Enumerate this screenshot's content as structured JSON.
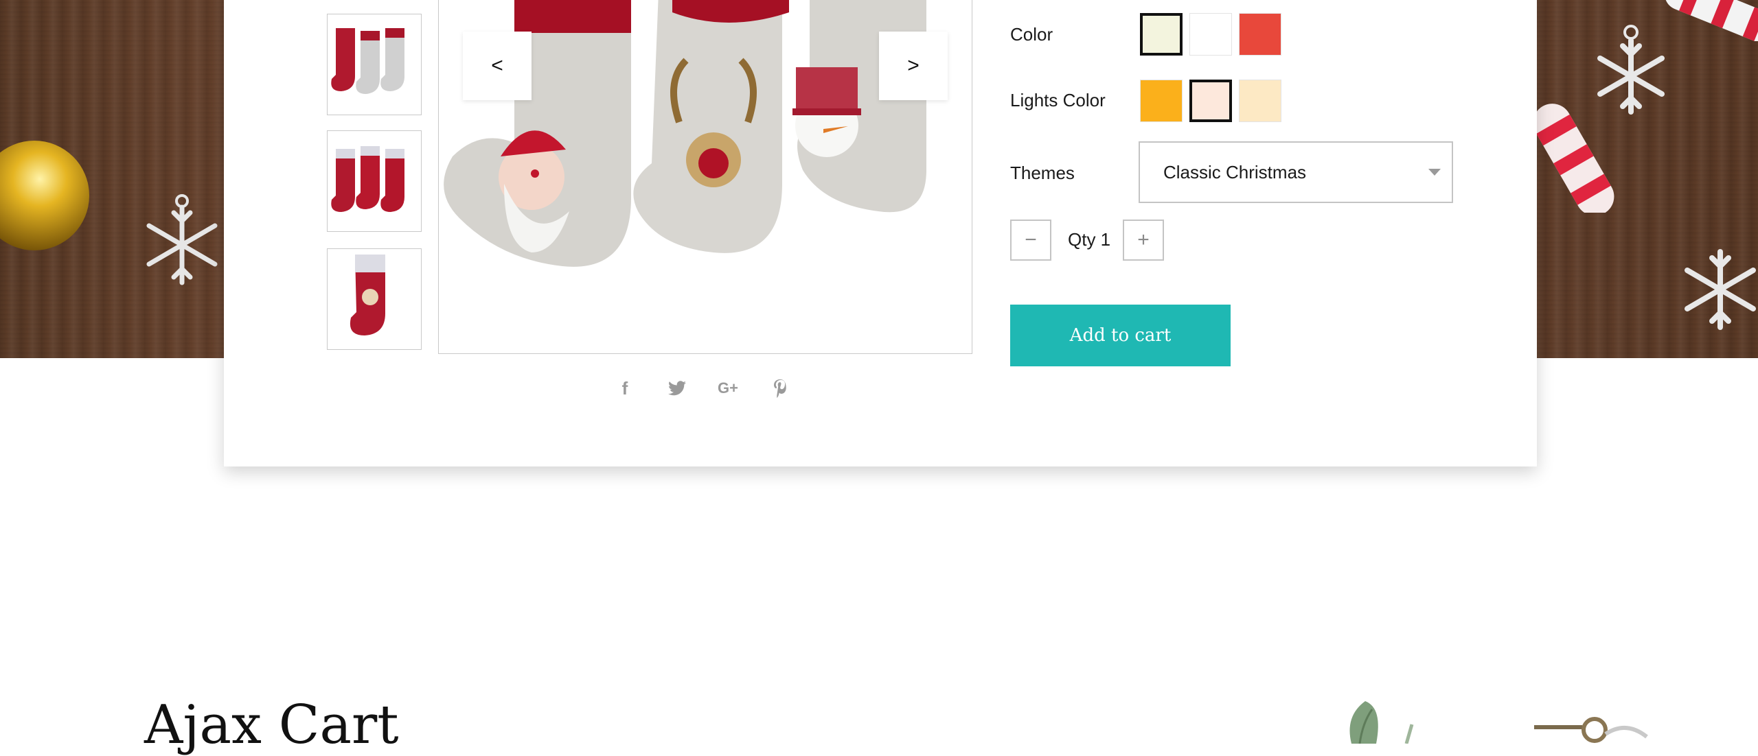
{
  "gallery": {
    "prev_label": "<",
    "next_label": ">",
    "thumbnail_count": 3
  },
  "share": {
    "facebook": "f",
    "twitter": "twitter-icon",
    "googleplus": "G+",
    "pinterest": "pinterest-icon"
  },
  "options": {
    "color": {
      "label": "Color",
      "swatches": [
        "#f3f4de",
        "#ffffff",
        "#e8483b"
      ],
      "selected_index": 0
    },
    "lights_color": {
      "label": "Lights Color",
      "swatches": [
        "#fbb01b",
        "#fde8dc",
        "#fde9c4"
      ],
      "selected_index": 1
    },
    "themes": {
      "label": "Themes",
      "value": "Classic Christmas"
    }
  },
  "quantity": {
    "minus": "−",
    "text": "Qty 1",
    "plus": "+"
  },
  "add_to_cart": "Add to cart",
  "accent_color": "#1fb8b3",
  "section_title": "Ajax Cart"
}
